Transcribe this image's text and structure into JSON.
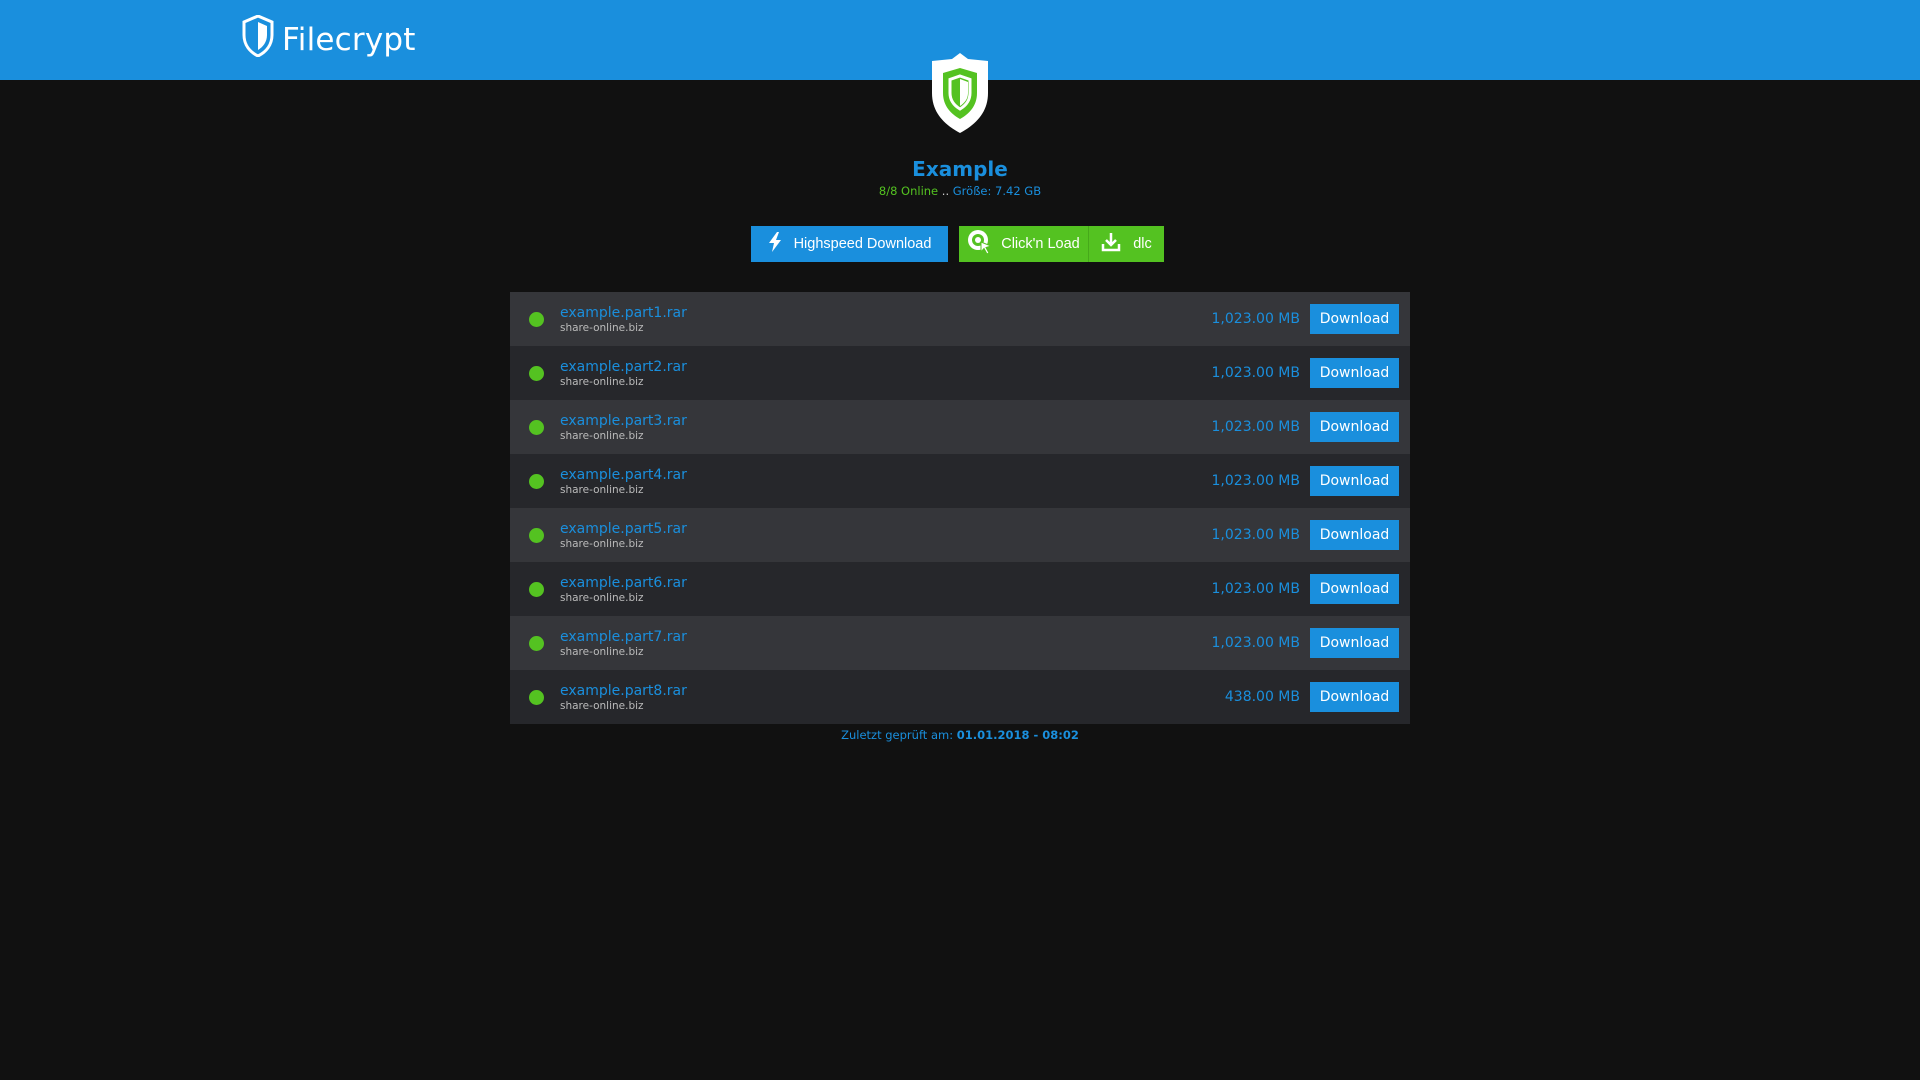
{
  "header": {
    "brand": "Filecrypt"
  },
  "container": {
    "title": "Example",
    "online_status": "8/8 Online",
    "separator": "..",
    "size_text": "Größe: 7.42 GB"
  },
  "actions": {
    "highspeed_label": "Highspeed Download",
    "clicknload_label": "Click'n Load",
    "dlc_label": "dlc"
  },
  "files": [
    {
      "name": "example.part1.rar",
      "host": "share-online.biz",
      "size": "1,023.00 MB",
      "button": "Download",
      "status": "online"
    },
    {
      "name": "example.part2.rar",
      "host": "share-online.biz",
      "size": "1,023.00 MB",
      "button": "Download",
      "status": "online"
    },
    {
      "name": "example.part3.rar",
      "host": "share-online.biz",
      "size": "1,023.00 MB",
      "button": "Download",
      "status": "online"
    },
    {
      "name": "example.part4.rar",
      "host": "share-online.biz",
      "size": "1,023.00 MB",
      "button": "Download",
      "status": "online"
    },
    {
      "name": "example.part5.rar",
      "host": "share-online.biz",
      "size": "1,023.00 MB",
      "button": "Download",
      "status": "online"
    },
    {
      "name": "example.part6.rar",
      "host": "share-online.biz",
      "size": "1,023.00 MB",
      "button": "Download",
      "status": "online"
    },
    {
      "name": "example.part7.rar",
      "host": "share-online.biz",
      "size": "1,023.00 MB",
      "button": "Download",
      "status": "online"
    },
    {
      "name": "example.part8.rar",
      "host": "share-online.biz",
      "size": "438.00 MB",
      "button": "Download",
      "status": "online"
    }
  ],
  "footer": {
    "label": "Zuletzt geprüft am:",
    "timestamp": "01.01.2018 - 08:02"
  },
  "colors": {
    "primary": "#1a8fdd",
    "success": "#54c221",
    "background": "#111111",
    "row_light": "#35363a",
    "row_dark": "#26272b"
  },
  "icons": {
    "brand": "shield-icon",
    "hero": "shield-icon",
    "highspeed": "lightning-icon",
    "clicknload": "click-n-load-icon",
    "dlc": "download-icon",
    "status": "online-dot-icon"
  }
}
